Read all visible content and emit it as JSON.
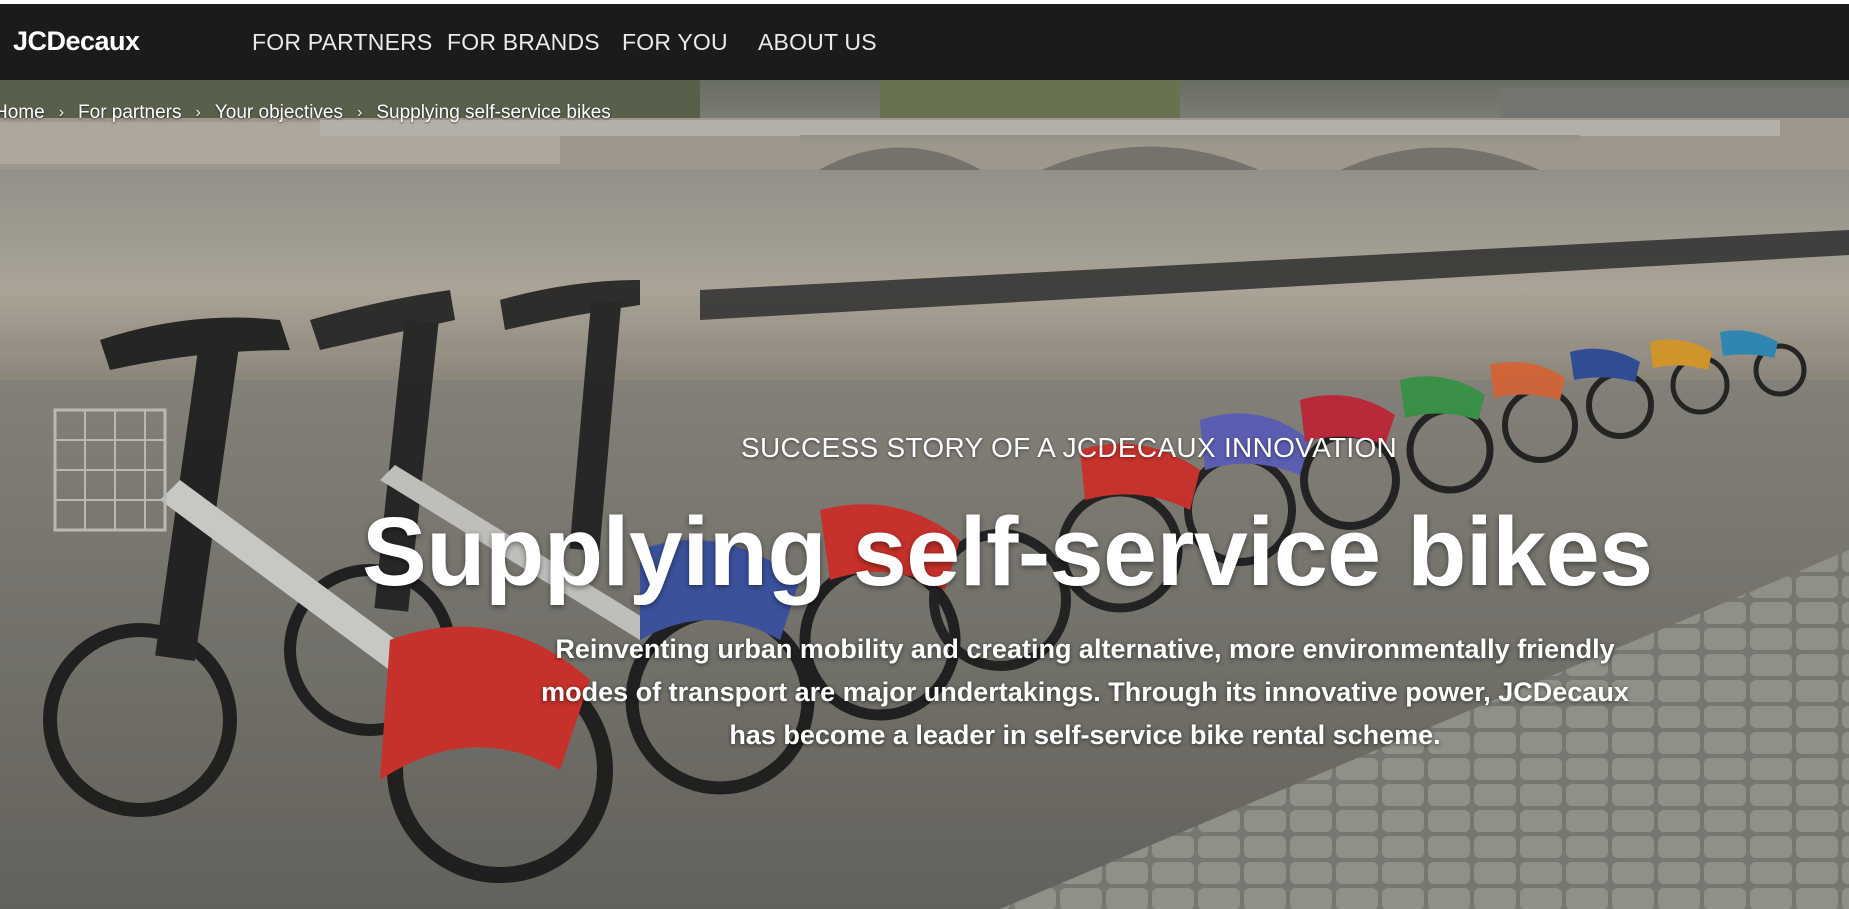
{
  "brand": {
    "logo": "JCDecaux"
  },
  "nav": {
    "items": [
      {
        "label": "FOR PARTNERS"
      },
      {
        "label": "FOR BRANDS"
      },
      {
        "label": "FOR YOU"
      },
      {
        "label": "ABOUT US"
      }
    ]
  },
  "breadcrumb": {
    "items": [
      {
        "label": "Home"
      },
      {
        "label": "For partners"
      },
      {
        "label": "Your objectives"
      },
      {
        "label": "Supplying self-service bikes"
      }
    ]
  },
  "hero": {
    "eyebrow": "SUCCESS STORY OF A JCDECAUX INNOVATION",
    "title": "Supplying self-service bikes",
    "description": "Reinventing urban mobility and creating alternative, more environmentally friendly modes of transport are major undertakings. Through its innovative power, JCDecaux has become a leader in self-service bike rental scheme.",
    "image": "bike-station-photo"
  },
  "colors": {
    "nav_background": "#1b1b1b",
    "text": "#ffffff"
  }
}
